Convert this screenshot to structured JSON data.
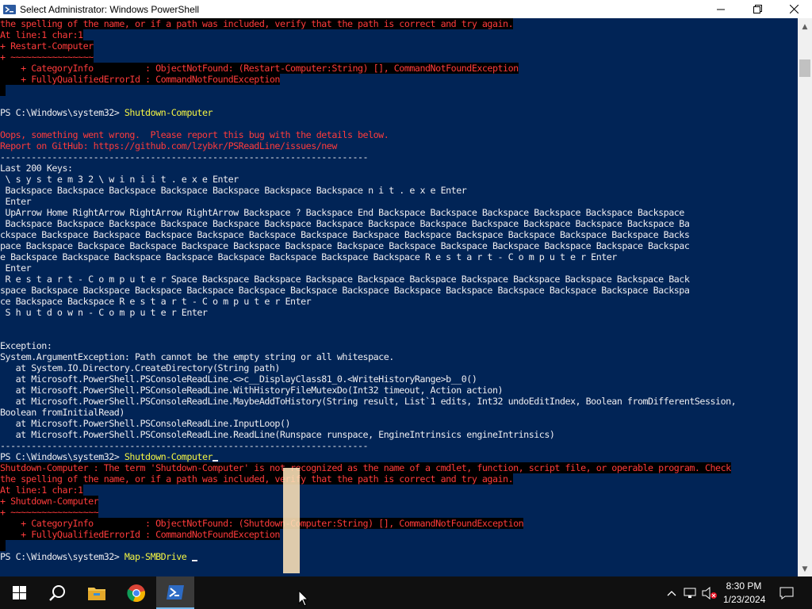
{
  "window": {
    "title": "Select Administrator: Windows PowerShell",
    "minimize_glyph": "—",
    "maximize_glyph": "❐",
    "close_glyph": "✕"
  },
  "console": {
    "lines": [
      {
        "text": "the spelling of the name, or if a path was included, verify that the path is correct and try again.",
        "style": "errbg-err"
      },
      {
        "text": "At line:1 char:1",
        "style": "errbg-err"
      },
      {
        "text": "+ Restart-Computer",
        "style": "errbg-err"
      },
      {
        "text": "+ ~~~~~~~~~~~~~~~~",
        "style": "errbg-err"
      },
      {
        "text": "    + CategoryInfo          : ObjectNotFound: (Restart-Computer:String) [], CommandNotFoundException",
        "style": "errbg-err"
      },
      {
        "text": "    + FullyQualifiedErrorId : CommandNotFoundException",
        "style": "errbg-err"
      },
      {
        "text": " ",
        "style": "errbg"
      },
      {
        "text": "",
        "style": "normal"
      },
      {
        "text": "PS C:\\Windows\\system32> ",
        "cmd": "Shutdown-Computer",
        "style": "prompt"
      },
      {
        "text": "",
        "style": "normal"
      },
      {
        "text": "Oops, something went wrong.  Please report this bug with the details below.",
        "style": "err"
      },
      {
        "text": "Report on GitHub: https://github.com/lzybkr/PSReadLine/issues/new",
        "style": "err"
      },
      {
        "text": "-----------------------------------------------------------------------",
        "style": "normal"
      },
      {
        "text": "Last 200 Keys:",
        "style": "normal"
      },
      {
        "text": " \\ s y s t e m 3 2 \\ w i n i i t . e x e Enter",
        "style": "normal"
      },
      {
        "text": " Backspace Backspace Backspace Backspace Backspace Backspace Backspace n i t . e x e Enter",
        "style": "normal"
      },
      {
        "text": " Enter",
        "style": "normal"
      },
      {
        "text": " UpArrow Home RightArrow RightArrow RightArrow Backspace ? Backspace End Backspace Backspace Backspace Backspace Backspace Backspace",
        "style": "normal"
      },
      {
        "text": " Backspace Backspace Backspace Backspace Backspace Backspace Backspace Backspace Backspace Backspace Backspace Backspace Backspace Ba",
        "style": "normal"
      },
      {
        "text": "ckspace Backspace Backspace Backspace Backspace Backspace Backspace Backspace Backspace Backspace Backspace Backspace Backspace Backs",
        "style": "normal"
      },
      {
        "text": "pace Backspace Backspace Backspace Backspace Backspace Backspace Backspace Backspace Backspace Backspace Backspace Backspace Backspac",
        "style": "normal"
      },
      {
        "text": "e Backspace Backspace Backspace Backspace Backspace Backspace Backspace Backspace R e s t a r t - C o m p u t e r Enter",
        "style": "normal"
      },
      {
        "text": " Enter",
        "style": "normal"
      },
      {
        "text": " R e s t a r t - C o m p u t e r Space Backspace Backspace Backspace Backspace Backspace Backspace Backspace Backspace Backspace Back",
        "style": "normal"
      },
      {
        "text": "space Backspace Backspace Backspace Backspace Backspace Backspace Backspace Backspace Backspace Backspace Backspace Backspace Backspa",
        "style": "normal"
      },
      {
        "text": "ce Backspace Backspace R e s t a r t - C o m p u t e r Enter",
        "style": "normal"
      },
      {
        "text": " S h u t d o w n - C o m p u t e r Enter",
        "style": "normal"
      },
      {
        "text": "",
        "style": "normal"
      },
      {
        "text": "",
        "style": "normal"
      },
      {
        "text": "Exception:",
        "style": "normal"
      },
      {
        "text": "System.ArgumentException: Path cannot be the empty string or all whitespace.",
        "style": "normal"
      },
      {
        "text": "   at System.IO.Directory.CreateDirectory(String path)",
        "style": "normal"
      },
      {
        "text": "   at Microsoft.PowerShell.PSConsoleReadLine.<>c__DisplayClass81_0.<WriteHistoryRange>b__0()",
        "style": "normal"
      },
      {
        "text": "   at Microsoft.PowerShell.PSConsoleReadLine.WithHistoryFileMutexDo(Int32 timeout, Action action)",
        "style": "normal"
      },
      {
        "text": "   at Microsoft.PowerShell.PSConsoleReadLine.MaybeAddToHistory(String result, List`1 edits, Int32 undoEditIndex, Boolean fromDifferentSession,",
        "style": "normal"
      },
      {
        "text": "Boolean fromInitialRead)",
        "style": "normal"
      },
      {
        "text": "   at Microsoft.PowerShell.PSConsoleReadLine.InputLoop()",
        "style": "normal"
      },
      {
        "text": "   at Microsoft.PowerShell.PSConsoleReadLine.ReadLine(Runspace runspace, EngineIntrinsics engineIntrinsics)",
        "style": "normal"
      },
      {
        "text": "-----------------------------------------------------------------------",
        "style": "normal"
      },
      {
        "text": "PS C:\\Windows\\system32> ",
        "cmd": "Shutdown-Computer",
        "style": "prompt",
        "cursor": true
      },
      {
        "text": "Shutdown-Computer : The term 'Shutdown-Computer' is not recognized as the name of a cmdlet, function, script file, or operable program. Check",
        "style": "errbg-err"
      },
      {
        "text": "the spelling of the name, or if a path was included, verify that the path is correct and try again.",
        "style": "errbg-err"
      },
      {
        "text": "At line:1 char:1",
        "style": "errbg-err"
      },
      {
        "text": "+ Shutdown-Computer",
        "style": "errbg-err"
      },
      {
        "text": "+ ~~~~~~~~~~~~~~~~~",
        "style": "errbg-err"
      },
      {
        "text": "    + CategoryInfo          : ObjectNotFound: (Shutdown-Computer:String) [], CommandNotFoundException",
        "style": "errbg-err"
      },
      {
        "text": "    + FullyQualifiedErrorId : CommandNotFoundException",
        "style": "errbg-err"
      },
      {
        "text": " ",
        "style": "errbg"
      },
      {
        "text": "PS C:\\Windows\\system32> ",
        "cmd": "Map-SMBDrive ",
        "style": "prompt",
        "cursor": true
      }
    ]
  },
  "taskbar": {
    "apps": [
      {
        "name": "start-icon"
      },
      {
        "name": "search-icon"
      },
      {
        "name": "file-explorer-icon"
      },
      {
        "name": "chrome-icon"
      },
      {
        "name": "powershell-icon",
        "active": true
      }
    ],
    "clock": {
      "time": "8:30 PM",
      "date": "1/23/2024"
    }
  },
  "colors": {
    "console_bg": "#012456",
    "console_fg": "#eeedf0",
    "error_fg": "#ff3b3b",
    "command_fg": "#f5f543",
    "taskbar_bg": "#101010"
  }
}
